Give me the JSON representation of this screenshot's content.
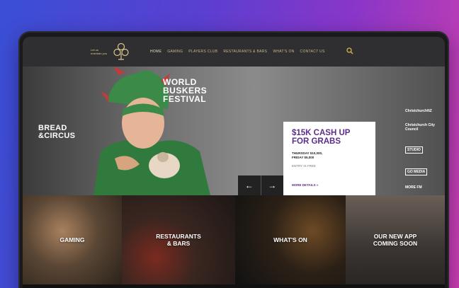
{
  "nav": {
    "logo_text": "Let us\nentertain you",
    "items": [
      {
        "label": "Home",
        "active": true
      },
      {
        "label": "Gaming",
        "active": false
      },
      {
        "label": "Players Club",
        "active": false
      },
      {
        "label": "Restaurants & Bars",
        "active": false
      },
      {
        "label": "What's On",
        "active": false
      },
      {
        "label": "Contact Us",
        "active": false
      }
    ],
    "search_icon": "search-icon"
  },
  "hero": {
    "left_title": "BREAD\n&CIRCUS",
    "right_title": "WORLD\nBUSKERS\nFESTIVAL",
    "promo": {
      "title": "$15K CASH UP\nFOR GRABS",
      "prize_line1": "THURSDAY $10,000,",
      "prize_line2": "FRIDAY $5,000",
      "entry": "ENTRY IS FREE",
      "link": "MORE DETAILS »"
    },
    "prev_icon": "arrow-left-icon",
    "next_icon": "arrow-right-icon",
    "sponsors": [
      "ChristchurchNZ",
      "Christchurch City Council",
      "STUDIO",
      "GO MEDIA",
      "MORE FM"
    ]
  },
  "tiles": [
    {
      "label": "GAMING"
    },
    {
      "label": "RESTAURANTS\n& BARS"
    },
    {
      "label": "WHAT'S ON"
    },
    {
      "label": "OUR NEW APP\nCOMING SOON"
    }
  ],
  "colors": {
    "accent_purple": "#5b2d8a",
    "nav_gold": "#c9b98a"
  }
}
